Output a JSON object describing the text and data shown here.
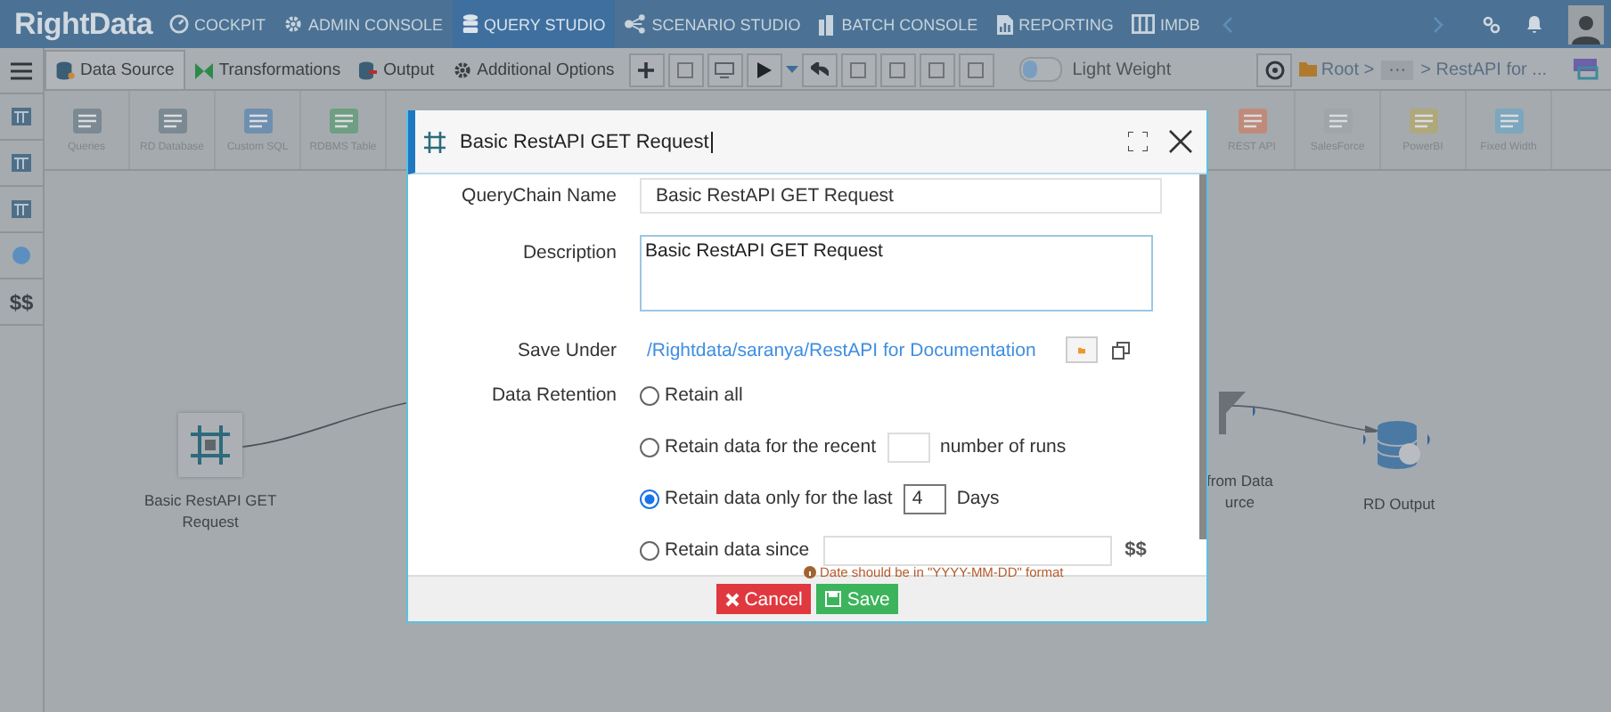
{
  "top_nav": {
    "logo": "RightData",
    "items": [
      {
        "label": "COCKPIT",
        "selected": false
      },
      {
        "label": "ADMIN CONSOLE",
        "selected": false
      },
      {
        "label": "QUERY STUDIO",
        "selected": true
      },
      {
        "label": "SCENARIO STUDIO",
        "selected": false
      },
      {
        "label": "BATCH CONSOLE",
        "selected": false
      },
      {
        "label": "REPORTING",
        "selected": false
      },
      {
        "label": "IMDB",
        "selected": false
      }
    ]
  },
  "toolbar": {
    "tabs": [
      {
        "label": "Data Source",
        "selected": true
      },
      {
        "label": "Transformations",
        "selected": false
      },
      {
        "label": "Output",
        "selected": false
      },
      {
        "label": "Additional Options",
        "selected": false
      }
    ],
    "toggle": {
      "label": "Light Weight",
      "on": false
    },
    "breadcrumb": [
      {
        "kind": "folder",
        "text": "Root >"
      },
      {
        "kind": "ellipsis",
        "text": "···"
      },
      {
        "kind": "plain",
        "text": "> RestAPI for ..."
      }
    ]
  },
  "palette": {
    "left": [
      {
        "label": "Queries"
      },
      {
        "label": "RD Database"
      },
      {
        "label": "Custom SQL"
      },
      {
        "label": "RDBMS Table"
      }
    ],
    "right": [
      {
        "label": "REST API"
      },
      {
        "label": "SalesForce"
      },
      {
        "label": "PowerBI"
      },
      {
        "label": "Fixed Width"
      }
    ]
  },
  "sidebar": {
    "items": [
      {
        "kind": "icon"
      },
      {
        "kind": "icon"
      },
      {
        "kind": "icon"
      },
      {
        "kind": "icon"
      },
      {
        "kind": "text",
        "text": "$$"
      }
    ]
  },
  "canvas": {
    "nodes": [
      {
        "kind": "source",
        "lines": [
          "Basic RestAPI GET",
          "Request"
        ]
      },
      {
        "kind": "filter",
        "lines": [
          "from Data",
          "urce"
        ]
      },
      {
        "kind": "output",
        "lines": [
          "RD Output"
        ]
      }
    ]
  },
  "dialog": {
    "title": "Basic RestAPI GET Request",
    "name": {
      "label": "QueryChain Name",
      "value": "Basic RestAPI GET Request"
    },
    "description": {
      "label": "Description",
      "value": "Basic RestAPI GET Request"
    },
    "save_under": {
      "label": "Save Under",
      "path": "/Rightdata/saranya/RestAPI for Documentation"
    },
    "retention": {
      "label": "Data Retention",
      "options": [
        {
          "kind": "plain",
          "text": "Retain all",
          "selected": false
        },
        {
          "kind": "number",
          "text": "Retain data for the recent",
          "suffix": "number of runs",
          "selected": false
        },
        {
          "kind": "number",
          "text": "Retain data only for the last",
          "value": "4",
          "suffix": "Days",
          "selected": true
        },
        {
          "kind": "date",
          "text": "Retain data since",
          "suffix": "$$",
          "hint": "Date should be in \"YYYY-MM-DD\" format",
          "selected": false
        }
      ]
    },
    "buttons": [
      {
        "kind": "cancel",
        "label": "Cancel"
      },
      {
        "kind": "save",
        "label": "Save"
      }
    ]
  }
}
